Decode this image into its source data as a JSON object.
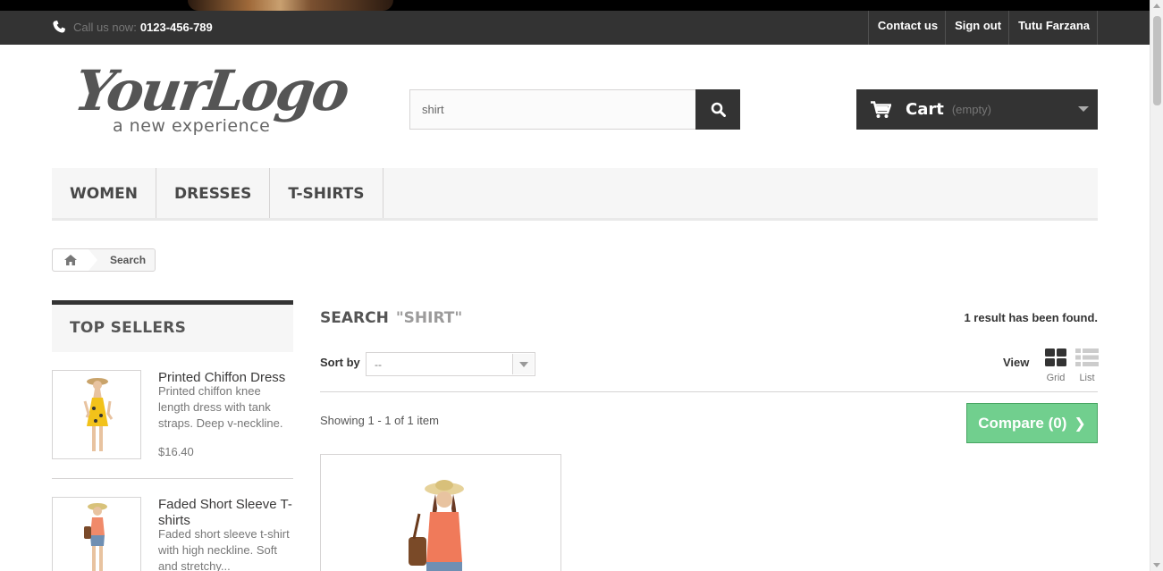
{
  "header": {
    "phone_prefix": "Call us now:",
    "phone_number": "0123-456-789",
    "links": [
      {
        "label": "Contact us"
      },
      {
        "label": "Sign out"
      },
      {
        "label": "Tutu Farzana"
      }
    ]
  },
  "logo": {
    "main": "YourLogo",
    "tagline": "a new experience"
  },
  "search": {
    "value": "shirt",
    "button_icon": "search-icon"
  },
  "cart": {
    "label": "Cart",
    "status": "(empty)"
  },
  "menu": {
    "items": [
      {
        "label": "Women"
      },
      {
        "label": "Dresses"
      },
      {
        "label": "T-shirts"
      }
    ]
  },
  "breadcrumb": {
    "home_icon": "home-icon",
    "current": "Search"
  },
  "sidebar": {
    "title": "Top sellers",
    "products": [
      {
        "name": "Printed Chiffon Dress",
        "description": "Printed chiffon knee length dress with tank straps. Deep v-neckline.",
        "price": "$16.40"
      },
      {
        "name": "Faded Short Sleeve T-shirts",
        "description": "Faded short sleeve t-shirt with high neckline. Soft and stretchy...",
        "price": ""
      }
    ]
  },
  "main": {
    "heading": "Search",
    "query": "\"shirt\"",
    "result_count": "1 result has been found.",
    "sort_label": "Sort by",
    "sort_value": "--",
    "view_label": "View",
    "view_grid": "Grid",
    "view_list": "List",
    "showing": "Showing 1 - 1 of 1 item",
    "compare_label": "Compare (0)"
  },
  "colors": {
    "dark": "#333333",
    "compare_green": "#71cf8e",
    "panel_bg": "#f6f6f6"
  }
}
